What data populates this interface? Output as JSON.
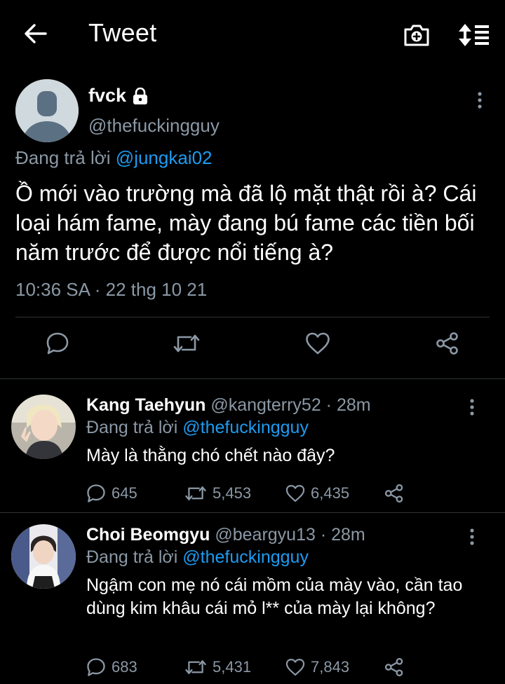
{
  "header": {
    "title": "Tweet",
    "back_icon": "arrow-left-icon",
    "camera_icon": "camera-plus-icon",
    "sort_icon": "sort-icon"
  },
  "main_tweet": {
    "display_name": "fvck",
    "protected_icon": "lock-icon",
    "handle": "@thefuckingguy",
    "replying_prefix": "Đang trả lời",
    "replying_to": "@jungkai02",
    "text": "Ồ mới vào trường mà đã lộ mặt thật rồi à? Cái loại hám fame, mày đang bú fame các tiền bối năm trước để được nổi tiếng à?",
    "timestamp": "10:36 SA · 22 thg 10 21"
  },
  "replies": [
    {
      "display_name": "Kang Taehyun",
      "meta": " @kangterry52 · 28m",
      "replying_prefix": "Đang trả lời",
      "replying_to": "@thefuckingguy",
      "text": "Mày là thằng chó chết nào đây?",
      "reply_count": "645",
      "retweet_count": "5,453",
      "like_count": "6,435"
    },
    {
      "display_name": "Choi Beomgyu",
      "meta": " @beargyu13 · 28m",
      "replying_prefix": "Đang trả lời",
      "replying_to": "@thefuckingguy",
      "text": "Ngậm con mẹ nó cái mồm của mày vào, cần tao dùng kim khâu cái mỏ l** của mày lại không?",
      "reply_count": "683",
      "retweet_count": "5,431",
      "like_count": "7,843"
    }
  ],
  "colors": {
    "background": "#000000",
    "text": "#ffffff",
    "secondary": "#8b98a5",
    "link": "#1d9bf0",
    "divider": "#2f3336"
  }
}
